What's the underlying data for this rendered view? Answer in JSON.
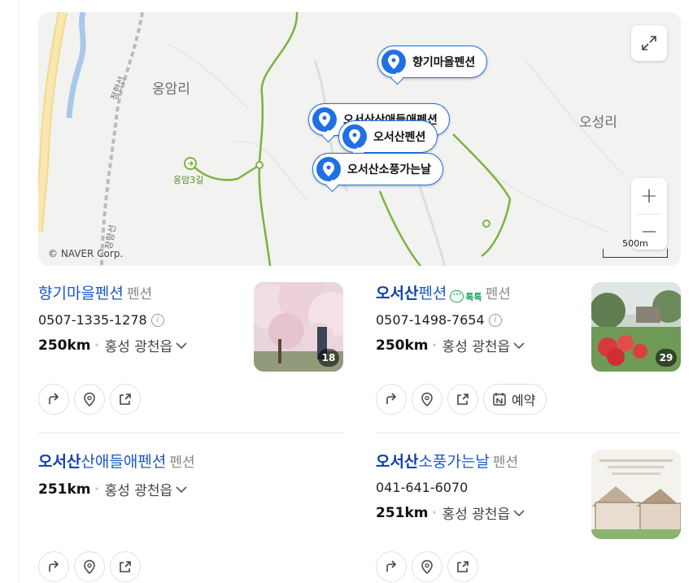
{
  "map": {
    "labels": [
      "옹암리",
      "오성리",
      "정한선",
      "장항선",
      "옹암3길"
    ],
    "copyright": "© NAVER Corp.",
    "scale_label": "500m",
    "pins": [
      "향기마을펜션",
      "오서산산애들애펜션",
      "오서산펜션",
      "오서산소풍가는날"
    ],
    "controls": {
      "expand_icon": "expand-icon",
      "zoom_in": "+",
      "zoom_out": "−"
    }
  },
  "results": [
    {
      "title_bold": "",
      "title_rest": "향기마을펜션",
      "category": "펜션",
      "phone": "0507-1335-1278",
      "distance": "250km",
      "address": "홍성 광천읍",
      "photo_count": "18",
      "actions": [
        "directions-icon",
        "location-icon",
        "share-icon"
      ]
    },
    {
      "title_bold": "오서산",
      "title_rest": "펜션",
      "talk_label": "톡톡",
      "category": "펜션",
      "phone": "0507-1498-7654",
      "distance": "250km",
      "address": "홍성 광천읍",
      "photo_count": "29",
      "reserve_label": "예약",
      "actions": [
        "directions-icon",
        "location-icon",
        "share-icon",
        "naver-booking-icon"
      ]
    },
    {
      "title_bold": "오서산",
      "title_rest": "산애들애펜션",
      "category": "펜션",
      "distance": "251km",
      "address": "홍성 광천읍",
      "actions": [
        "directions-icon",
        "location-icon",
        "share-icon"
      ]
    },
    {
      "title_bold": "오서산",
      "title_rest": "소풍가는날",
      "category": "펜션",
      "phone": "041-641-6070",
      "distance": "251km",
      "address": "홍성 광천읍",
      "actions": [
        "directions-icon",
        "location-icon",
        "share-icon"
      ]
    }
  ],
  "colors": {
    "accent": "#1f6fe6",
    "title": "#1a58c9",
    "talk": "#1aa35a",
    "road": "#7cb342"
  }
}
